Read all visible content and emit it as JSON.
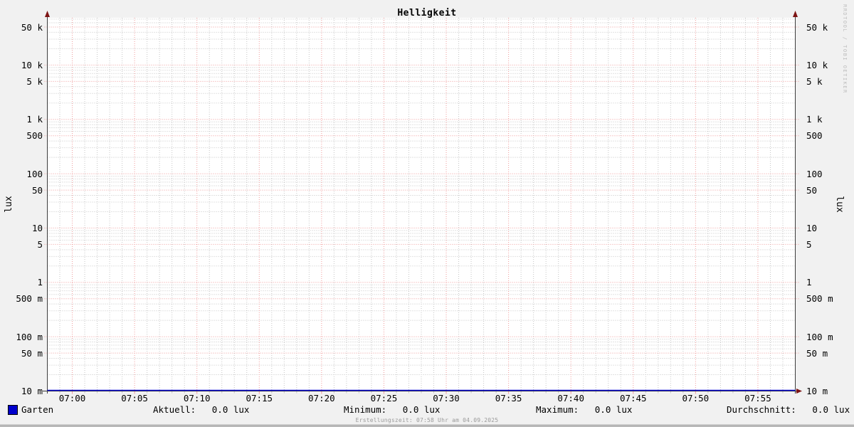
{
  "title": "Helligkeit",
  "watermark": "RRDTOOL / TOBI OETIKER",
  "axis_units": {
    "left": "lux",
    "right": "lux"
  },
  "legend": {
    "series_name": "Garten",
    "aktuell": "Aktuell:   0.0 lux",
    "minimum": "Minimum:   0.0 lux",
    "maximum": "Maximum:   0.0 lux",
    "durchschnitt": "Durchschnitt:   0.0 lux"
  },
  "footer": {
    "created": "Erstellungszeit: 07:58 Uhr am 04.09.2025"
  },
  "colors": {
    "background": "#f1f1f1",
    "canvas": "#ffffff",
    "major_grid": "#f09c9c",
    "minor_grid": "#c6c6c6",
    "axis": "#3d3d3d",
    "arrow": "#7d1414",
    "series_garten": "#0000cc",
    "watermark_text": "#bdbdbd",
    "footer_text": "#9a9a9a"
  },
  "chart_data": {
    "type": "line",
    "title": "Helligkeit",
    "ylabel": "lux",
    "y_scale": "logarithmic",
    "ylim_lux": [
      0.01,
      74000
    ],
    "y_major_ticks": [
      {
        "value": 50000,
        "label": "50 k"
      },
      {
        "value": 10000,
        "label": "10 k"
      },
      {
        "value": 5000,
        "label": "5 k"
      },
      {
        "value": 1000,
        "label": "1 k"
      },
      {
        "value": 500,
        "label": "500"
      },
      {
        "value": 100,
        "label": "100"
      },
      {
        "value": 50,
        "label": "50"
      },
      {
        "value": 10,
        "label": "10"
      },
      {
        "value": 5,
        "label": "5"
      },
      {
        "value": 1,
        "label": "1"
      },
      {
        "value": 0.5,
        "label": "500 m"
      },
      {
        "value": 0.1,
        "label": "100 m"
      },
      {
        "value": 0.05,
        "label": "50 m"
      },
      {
        "value": 0.01,
        "label": "10 m"
      }
    ],
    "y_minor_multipliers": [
      2,
      3,
      4,
      6,
      7,
      8,
      9
    ],
    "x_start": "06:58",
    "x_end": "07:58",
    "x_major_ticks": [
      "07:00",
      "07:05",
      "07:10",
      "07:15",
      "07:20",
      "07:25",
      "07:30",
      "07:35",
      "07:40",
      "07:45",
      "07:50",
      "07:55"
    ],
    "x_minor_step_min": 1,
    "grid": {
      "style": "dotted",
      "major_color": "#f09c9c",
      "minor_color": "#c6c6c6"
    },
    "legend_position": "bottom",
    "series": [
      {
        "name": "Garten",
        "color": "#0000cc",
        "x": [
          "06:58",
          "07:58"
        ],
        "values_lux": [
          0.0,
          0.0
        ]
      }
    ],
    "stats": {
      "aktuell_lux": 0.0,
      "minimum_lux": 0.0,
      "maximum_lux": 0.0,
      "durchschnitt_lux": 0.0
    }
  }
}
